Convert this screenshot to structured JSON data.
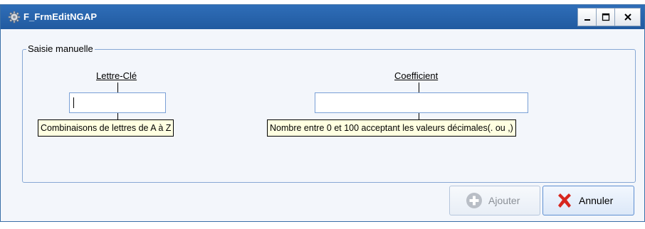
{
  "window": {
    "title": "F_FrmEditNGAP",
    "controls": {
      "minimize": "_",
      "maximize": "□",
      "close": "X"
    }
  },
  "group": {
    "legend": "Saisie manuelle"
  },
  "fields": {
    "lettre_cle": {
      "label": "Lettre-Clé",
      "value": "",
      "hint": "Combinaisons de lettres de A à Z"
    },
    "coefficient": {
      "label": "Coefficient",
      "value": "",
      "hint": "Nombre entre 0 et 100 acceptant les valeurs décimales(. ou ,)"
    }
  },
  "buttons": {
    "add_label": "Ajouter",
    "add_enabled": false,
    "cancel_label": "Annuler"
  },
  "icons": {
    "app": "gear-icon",
    "add": "plus-circle-icon",
    "cancel": "red-x-icon"
  },
  "colors": {
    "titlebar": "#215aa0",
    "tooltip_bg": "#ffffe1",
    "cancel_icon": "#d7261e"
  }
}
